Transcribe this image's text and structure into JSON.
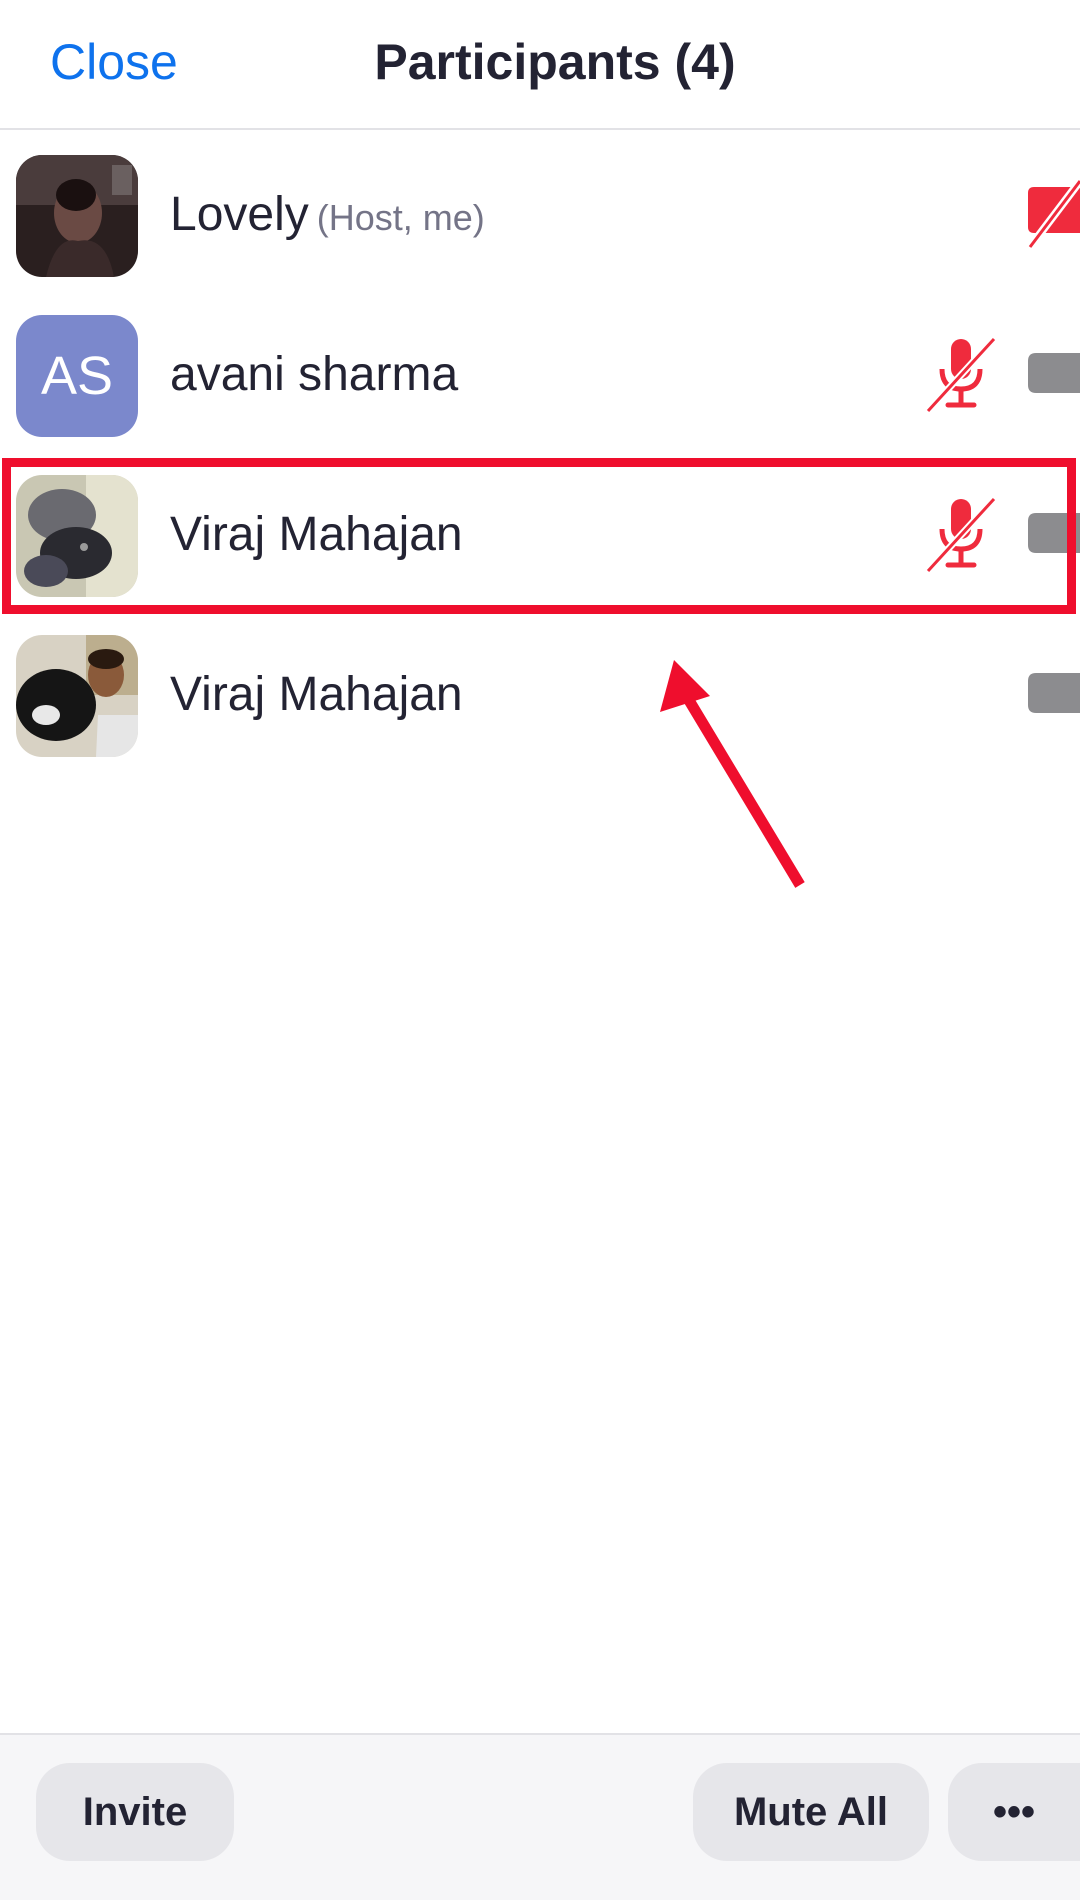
{
  "header": {
    "close_label": "Close",
    "title": "Participants (4)"
  },
  "participants": [
    {
      "name": "Lovely",
      "role": "(Host, me)",
      "avatar": "photo",
      "mic": "none",
      "video": "off-red"
    },
    {
      "name": "avani sharma",
      "role": "",
      "avatar": "initials",
      "initials": "AS",
      "mic": "muted",
      "video": "off"
    },
    {
      "name": "Viraj Mahajan",
      "role": "",
      "avatar": "photo",
      "mic": "muted",
      "video": "off",
      "highlighted": true
    },
    {
      "name": "Viraj Mahajan",
      "role": "",
      "avatar": "photo",
      "mic": "none",
      "video": "off"
    }
  ],
  "footer": {
    "invite_label": "Invite",
    "mute_all_label": "Mute All",
    "more_label": "•••"
  },
  "colors": {
    "accent": "#0e72ed",
    "muted_red": "#ef2b3d",
    "annotation_red": "#ef0e2d",
    "initials_avatar": "#7b88cc",
    "icon_gray": "#8c8c8f"
  },
  "icons": {
    "mic": "muted-mic-icon",
    "video": "video-off-icon",
    "more": "more-ellipsis-icon"
  }
}
